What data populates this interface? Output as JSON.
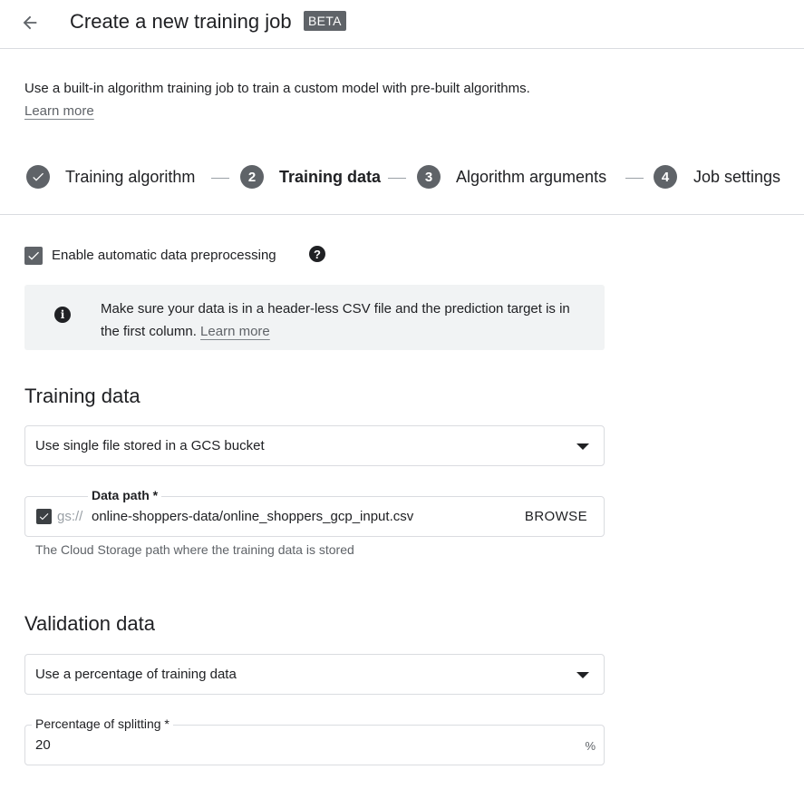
{
  "header": {
    "title": "Create a new training job",
    "badge": "BETA"
  },
  "intro": {
    "text": "Use a built-in algorithm training job to train a custom model with pre-built algorithms.",
    "learn_more": "Learn more"
  },
  "stepper": {
    "steps": [
      {
        "number": "",
        "label": "Training algorithm",
        "state": "completed"
      },
      {
        "number": "2",
        "label": "Training data",
        "state": "active"
      },
      {
        "number": "3",
        "label": "Algorithm arguments",
        "state": "pending"
      },
      {
        "number": "4",
        "label": "Job settings",
        "state": "pending"
      }
    ]
  },
  "preprocessing": {
    "label": "Enable automatic data preprocessing",
    "checked": true
  },
  "info": {
    "text": "Make sure your data is in a header-less CSV file and the prediction target is in the first column.",
    "learn_more": "Learn more"
  },
  "training_data": {
    "title": "Training data",
    "source_select": "Use single file stored in a GCS bucket",
    "path_label": "Data path *",
    "path_prefix": "gs://",
    "path_value": "online-shoppers-data/online_shoppers_gcp_input.csv",
    "browse_label": "BROWSE",
    "path_help": "The Cloud Storage path where the training data is stored"
  },
  "validation_data": {
    "title": "Validation data",
    "source_select": "Use a percentage of training data",
    "split_label": "Percentage of splitting *",
    "split_value": "20",
    "split_suffix": "%"
  },
  "colors": {
    "accent_gray": "#5f6368",
    "step_circle": "#5f6368",
    "info_bg": "#f1f3f4",
    "border": "#dadce0"
  }
}
